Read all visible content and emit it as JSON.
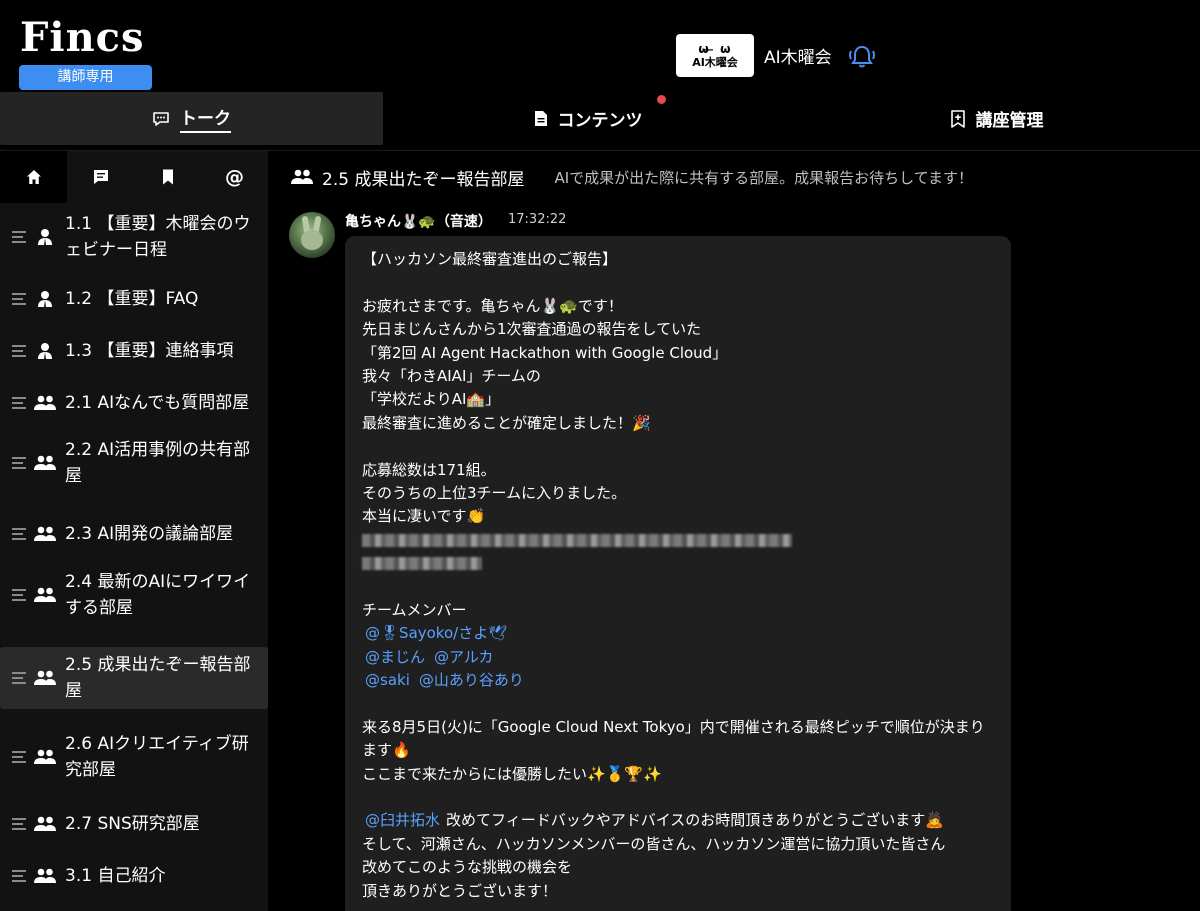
{
  "header": {
    "logo": "Fincs",
    "role_badge": "講師専用",
    "community_logo_top": "ω ̶ ω",
    "community_logo_text": "AI木曜会",
    "community_name": "AI木曜会",
    "bell_icon": "bell-ringing-icon"
  },
  "tabs": [
    {
      "label": "トーク",
      "icon": "chat-bubble-icon",
      "active": true
    },
    {
      "label": "コンテンツ",
      "icon": "document-icon",
      "active": false,
      "badge": true
    },
    {
      "label": "講座管理",
      "icon": "bookmark-plus-icon",
      "active": false
    }
  ],
  "sidebar": {
    "icons": [
      {
        "name": "home-icon",
        "active": true
      },
      {
        "name": "message-icon",
        "active": false
      },
      {
        "name": "bookmark-icon",
        "active": false
      },
      {
        "name": "mention-icon",
        "label": "@",
        "active": false
      }
    ],
    "rooms": [
      {
        "label": "1.1 【重要】木曜会のウェビナー日程",
        "icon": "person-icon"
      },
      {
        "label": "1.2 【重要】FAQ",
        "icon": "person-icon"
      },
      {
        "label": "1.3 【重要】連絡事項",
        "icon": "person-icon"
      },
      {
        "label": "2.1 AIなんでも質問部屋",
        "icon": "group-icon"
      },
      {
        "label": "2.2 AI活用事例の共有部屋",
        "icon": "group-icon"
      },
      {
        "label": "2.3 AI開発の議論部屋",
        "icon": "group-icon"
      },
      {
        "label": "2.4 最新のAIにワイワイする部屋",
        "icon": "group-icon"
      },
      {
        "label": "2.5 成果出たぞー報告部屋",
        "icon": "group-icon",
        "active": true
      },
      {
        "label": "2.6 AIクリエイティブ研究部屋",
        "icon": "group-icon"
      },
      {
        "label": "2.7 SNS研究部屋",
        "icon": "group-icon"
      },
      {
        "label": "3.1 自己紹介",
        "icon": "group-icon"
      }
    ]
  },
  "room": {
    "title": "2.5 成果出たぞー報告部屋",
    "description": "AIで成果が出た際に共有する部屋。成果報告お待ちしてます！"
  },
  "message": {
    "author": "亀ちゃん🐰🐢（音速）",
    "time": "17:32:22",
    "lines": [
      {
        "text": "【ハッカソン最終審査進出のご報告】"
      },
      {
        "text": ""
      },
      {
        "text": "お疲れさまです。亀ちゃん🐰🐢です！"
      },
      {
        "text": "先日まじんさんから1次審査通過の報告をしていた"
      },
      {
        "text": "「第2回 AI Agent Hackathon with Google Cloud」"
      },
      {
        "text": "我々「わきAIAI」チームの"
      },
      {
        "text": "「学校だよりAI🏫」"
      },
      {
        "text": "最終審査に進めることが確定しました！🎉"
      },
      {
        "text": ""
      },
      {
        "text": "応募総数は171組。"
      },
      {
        "text": "そのうちの上位3チームに入りました。"
      },
      {
        "text": "本当に凄いです👏"
      },
      {
        "blur": 430
      },
      {
        "blur": 120
      },
      {
        "text": ""
      },
      {
        "text": "チームメンバー"
      },
      {
        "mentions": [
          "@🎖Sayoko/さよ🕊"
        ]
      },
      {
        "mentions": [
          "@まじん",
          "@アルカ"
        ]
      },
      {
        "mentions": [
          "@saki",
          "@山あり谷あり"
        ]
      },
      {
        "text": ""
      },
      {
        "text": "来る8月5日(火)に「Google Cloud Next Tokyo」内で開催される最終ピッチで順位が決まり"
      },
      {
        "text": "ます🔥"
      },
      {
        "text": "ここまで来たからには優勝したい✨🥇🏆✨"
      },
      {
        "text": ""
      },
      {
        "mention": "@臼井拓水",
        "text": "改めてフィードバックやアドバイスのお時間頂きありがとうございます🙇"
      },
      {
        "text": "そして、河瀬さん、ハッカソンメンバーの皆さん、ハッカソン運営に協力頂いた皆さん"
      },
      {
        "text": "改めてこのような挑戦の機会を"
      },
      {
        "text": "頂きありがとうございます！"
      }
    ]
  },
  "colors": {
    "accent": "#3d8ef0",
    "mention": "#5aa0ff",
    "badge": "#e5484d",
    "sidebar_bg": "#121212",
    "bubble_bg": "#1f1f1f"
  }
}
